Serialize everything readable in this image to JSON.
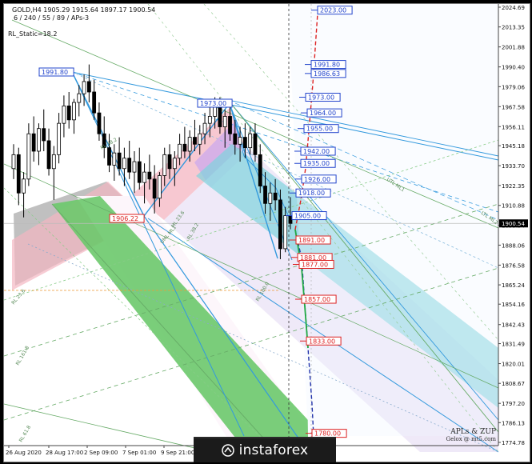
{
  "header": {
    "symbol_line": "GOLD,H4  1905.29 1915.64 1897.17 1900.54",
    "indicator_line": "6 / 240 / 55 / 89 / APs-3",
    "static_line": "RL_Static=18.2"
  },
  "chart_data": {
    "type": "candlestick",
    "symbol": "GOLD",
    "timeframe": "H4",
    "ohlc_last": {
      "open": 1905.29,
      "high": 1915.64,
      "low": 1897.17,
      "close": 1900.54
    },
    "current_price": 1900.54,
    "ylim": [
      1774.78,
      2024.69
    ],
    "y_ticks": [
      2024.69,
      2013.35,
      2001.88,
      1990.4,
      1979.06,
      1967.58,
      1956.11,
      1945.18,
      1933.7,
      1922.35,
      1910.88,
      1899.54,
      1888.06,
      1876.58,
      1865.24,
      1854.16,
      1842.43,
      1831.49,
      1820.01,
      1808.67,
      1797.2,
      1786.13,
      1774.78
    ],
    "x_ticks": [
      "26 Aug 2020",
      "28 Aug 17:00",
      "2 Sep 09:00",
      "7 Sep 01:00",
      "9 Sep 21:00"
    ],
    "candles": [
      [
        1932,
        1946,
        1926,
        1940
      ],
      [
        1940,
        1944,
        1911,
        1918
      ],
      [
        1918,
        1930,
        1904,
        1926
      ],
      [
        1926,
        1958,
        1922,
        1952
      ],
      [
        1952,
        1962,
        1936,
        1942
      ],
      [
        1942,
        1958,
        1934,
        1955
      ],
      [
        1955,
        1966,
        1942,
        1948
      ],
      [
        1948,
        1955,
        1928,
        1932
      ],
      [
        1932,
        1945,
        1914,
        1940
      ],
      [
        1940,
        1964,
        1935,
        1958
      ],
      [
        1958,
        1974,
        1950,
        1968
      ],
      [
        1968,
        1976,
        1955,
        1960
      ],
      [
        1960,
        1972,
        1952,
        1970
      ],
      [
        1970,
        1980,
        1962,
        1975
      ],
      [
        1975,
        1986,
        1968,
        1982
      ],
      [
        1982,
        1991.8,
        1970,
        1976
      ],
      [
        1976,
        1983,
        1960,
        1964
      ],
      [
        1964,
        1970,
        1948,
        1952
      ],
      [
        1952,
        1962,
        1938,
        1944
      ],
      [
        1944,
        1952,
        1930,
        1934
      ],
      [
        1934,
        1946,
        1925,
        1941
      ],
      [
        1941,
        1950,
        1928,
        1932
      ],
      [
        1932,
        1944,
        1922,
        1938
      ],
      [
        1938,
        1948,
        1926,
        1930
      ],
      [
        1930,
        1942,
        1918,
        1936
      ],
      [
        1936,
        1944,
        1920,
        1924
      ],
      [
        1924,
        1935,
        1912,
        1930
      ],
      [
        1930,
        1940,
        1920,
        1926
      ],
      [
        1926,
        1934,
        1906.22,
        1915
      ],
      [
        1915,
        1930,
        1910,
        1928
      ],
      [
        1928,
        1944,
        1922,
        1940
      ],
      [
        1940,
        1946,
        1926,
        1932
      ],
      [
        1932,
        1942,
        1922,
        1938
      ],
      [
        1938,
        1952,
        1934,
        1946
      ],
      [
        1946,
        1956,
        1938,
        1942
      ],
      [
        1942,
        1954,
        1936,
        1950
      ],
      [
        1950,
        1960,
        1942,
        1946
      ],
      [
        1946,
        1957,
        1940,
        1952
      ],
      [
        1952,
        1964,
        1946,
        1958
      ],
      [
        1958,
        1968,
        1950,
        1962
      ],
      [
        1962,
        1973,
        1955,
        1968
      ],
      [
        1968,
        1973,
        1952,
        1956
      ],
      [
        1956,
        1966,
        1944,
        1962
      ],
      [
        1962,
        1970,
        1948,
        1952
      ],
      [
        1952,
        1960,
        1940,
        1946
      ],
      [
        1946,
        1956,
        1936,
        1950
      ],
      [
        1950,
        1958,
        1938,
        1944
      ],
      [
        1944,
        1956,
        1940,
        1952
      ],
      [
        1952,
        1958,
        1936,
        1940
      ],
      [
        1940,
        1946,
        1918,
        1922
      ],
      [
        1922,
        1930,
        1906,
        1912
      ],
      [
        1912,
        1924,
        1902,
        1918
      ],
      [
        1918,
        1926,
        1908,
        1914
      ],
      [
        1914,
        1920,
        1880,
        1886
      ],
      [
        1886,
        1910,
        1884,
        1905
      ],
      [
        1905,
        1915.64,
        1897.17,
        1900.54
      ]
    ],
    "projection_levels": [
      {
        "value": "2023.00",
        "color": "#2244cc"
      },
      {
        "value": "1991.80",
        "color": "#2244cc"
      },
      {
        "value": "1986.63",
        "color": "#2244cc"
      },
      {
        "value": "1973.00",
        "color": "#2244cc"
      },
      {
        "value": "1964.00",
        "color": "#2244cc"
      },
      {
        "value": "1955.00",
        "color": "#2244cc"
      },
      {
        "value": "1942.00",
        "color": "#2244cc"
      },
      {
        "value": "1935.00",
        "color": "#2244cc"
      },
      {
        "value": "1926.00",
        "color": "#2244cc"
      },
      {
        "value": "1918.00",
        "color": "#2244cc"
      },
      {
        "value": "1905.00",
        "color": "#2244cc"
      },
      {
        "value": "1891.00",
        "color": "#dd2222"
      },
      {
        "value": "1881.00",
        "color": "#dd2222"
      },
      {
        "value": "1877.00",
        "color": "#dd2222"
      },
      {
        "value": "1857.00",
        "color": "#dd2222"
      },
      {
        "value": "1833.00",
        "color": "#dd2222"
      },
      {
        "value": "1780.00",
        "color": "#dd2222"
      }
    ],
    "pivot_labels": [
      {
        "value": "1991.80",
        "color": "#2244cc"
      },
      {
        "value": "1973.00",
        "color": "#2244cc"
      },
      {
        "value": "1906.22",
        "color": "#dd2222"
      }
    ],
    "fib_labels": [
      "RL 61.8",
      "RL 38.2",
      "RL 23.6",
      "RL 100.0",
      "UTL ML1",
      "LTL ML2",
      "RL 161.8",
      "UML ML1",
      "ML 23.6",
      "RL 38.2"
    ],
    "colors": {
      "price_marker_bg": "#000000",
      "blue_label": "#2244cc",
      "red_label": "#dd2222",
      "zone_pink": "#f4b6c2",
      "zone_gray": "#b5b5b5",
      "channel_green": "#6cc96c",
      "channel_cyan": "#7fd3dd",
      "channel_lavender": "#e9e2f6"
    }
  },
  "credits": {
    "line1": "APLs & ZUP",
    "line2": "Gelox @ mt5.com"
  },
  "brand": {
    "name": "instaforex"
  }
}
